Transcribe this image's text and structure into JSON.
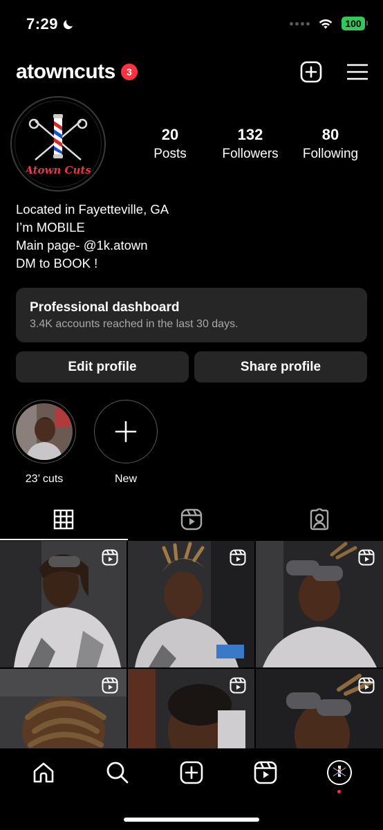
{
  "status_bar": {
    "time": "7:29",
    "battery": "100"
  },
  "header": {
    "username": "atowncuts",
    "notification_count": "3"
  },
  "profile": {
    "avatar_text": "Atown Cuts",
    "stats": [
      {
        "num": "20",
        "label": "Posts"
      },
      {
        "num": "132",
        "label": "Followers"
      },
      {
        "num": "80",
        "label": "Following"
      }
    ],
    "bio": [
      "Located in Fayetteville, GA",
      "I’m MOBILE",
      "Main page- @1k.atown",
      "DM to BOOK !"
    ]
  },
  "dashboard": {
    "title": "Professional dashboard",
    "subtitle": "3.4K accounts reached in the last 30 days."
  },
  "buttons": {
    "edit": "Edit profile",
    "share": "Share profile"
  },
  "highlights": [
    {
      "label": "23’ cuts"
    },
    {
      "label": "New"
    }
  ],
  "colors": {
    "background": "#000000",
    "surface": "#262626",
    "badge": "#ff3040",
    "battery": "#34c759",
    "muted": "#a8a8a8"
  }
}
